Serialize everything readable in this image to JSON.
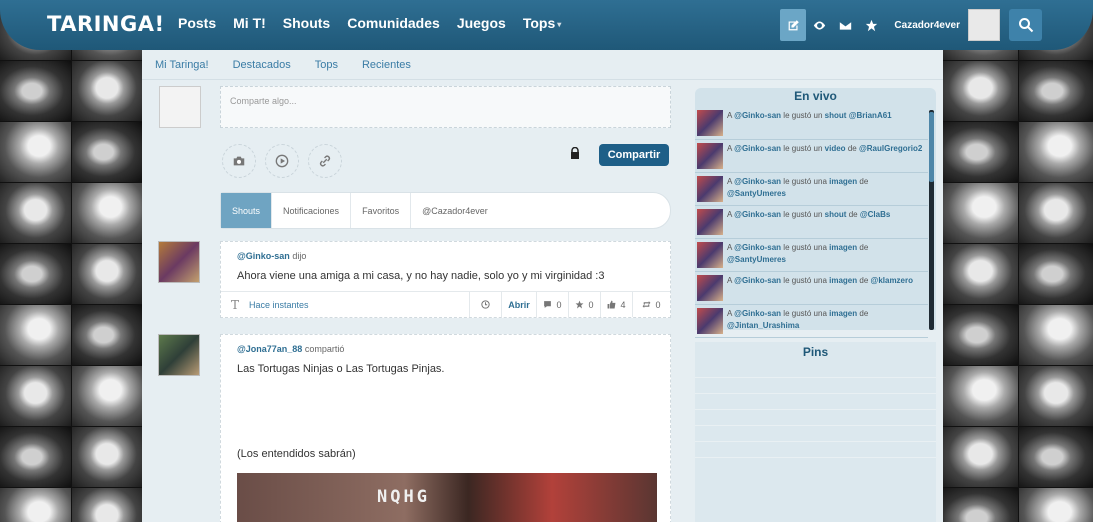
{
  "header": {
    "logo": "TARINGA!",
    "nav": [
      "Posts",
      "Mi T!",
      "Shouts",
      "Comunidades",
      "Juegos",
      "Tops"
    ],
    "caret": "▾",
    "username": "Cazador4ever",
    "icons": [
      "compose-icon",
      "eye-icon",
      "mail-icon",
      "star-icon",
      "search-icon"
    ]
  },
  "subnav": [
    "Mi Taringa!",
    "Destacados",
    "Tops",
    "Recientes"
  ],
  "share": {
    "placeholder": "Comparte algo...",
    "button": "Compartir"
  },
  "tabs": [
    "Shouts",
    "Notificaciones",
    "Favoritos",
    "@Cazador4ever"
  ],
  "posts": [
    {
      "user": "@Ginko-san",
      "action": "dijo",
      "text": "Ahora viene una amiga a mi casa, y no hay nadie, solo yo y mi virginidad :3",
      "glyph": "T",
      "time": "Hace instantes",
      "open": "Abrir",
      "comments": "0",
      "favs": "0",
      "likes": "4",
      "reshares": "0"
    },
    {
      "user": "@Jona77an_88",
      "action": "compartió",
      "text": "Las Tortugas Ninjas o Las Tortugas Pinjas.",
      "text2": "(Los entendidos sabrán)",
      "image_text": "NQHG"
    }
  ],
  "live": {
    "title": "En vivo",
    "items": [
      {
        "pre": "A",
        "user": "@Ginko-san",
        "mid": "le gustó un",
        "kind": "shout",
        "de": "",
        "target": "@BrianA61"
      },
      {
        "pre": "A",
        "user": "@Ginko-san",
        "mid": "le gustó un",
        "kind": "video",
        "de": "de",
        "target": "@RaulGregorio2"
      },
      {
        "pre": "A",
        "user": "@Ginko-san",
        "mid": "le gustó una",
        "kind": "imagen",
        "de": "de",
        "target": "@SantyUmeres"
      },
      {
        "pre": "A",
        "user": "@Ginko-san",
        "mid": "le gustó un",
        "kind": "shout",
        "de": "de",
        "target": "@ClaBs"
      },
      {
        "pre": "A",
        "user": "@Ginko-san",
        "mid": "le gustó una",
        "kind": "imagen",
        "de": "de",
        "target": "@SantyUmeres"
      },
      {
        "pre": "A",
        "user": "@Ginko-san",
        "mid": "le gustó una",
        "kind": "imagen",
        "de": "de",
        "target": "@klamzero"
      },
      {
        "pre": "A",
        "user": "@Ginko-san",
        "mid": "le gustó una",
        "kind": "imagen",
        "de": "de",
        "target": "@Jintan_Urashima"
      }
    ]
  },
  "pins": {
    "title": "Pins"
  }
}
